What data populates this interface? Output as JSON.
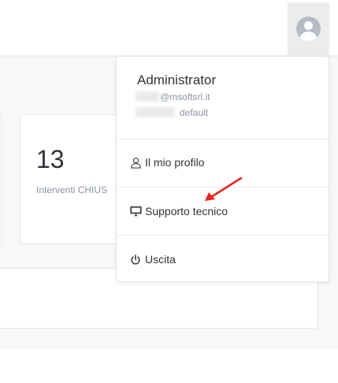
{
  "user_menu": {
    "name": "Administrator",
    "email_suffix": "@msoftsrl.it",
    "role": "default",
    "items": [
      {
        "label": "Il mio profilo",
        "icon": "user-icon"
      },
      {
        "label": "Supporto tecnico",
        "icon": "monitor-icon"
      },
      {
        "label": "Uscita",
        "icon": "power-icon"
      }
    ]
  },
  "stat_card": {
    "value": "13",
    "label": "Interventi CHIUS"
  },
  "colors": {
    "annotation_arrow": "#e8261f",
    "avatar_bg": "#b5bcc5",
    "muted_text": "#8a94a2"
  }
}
